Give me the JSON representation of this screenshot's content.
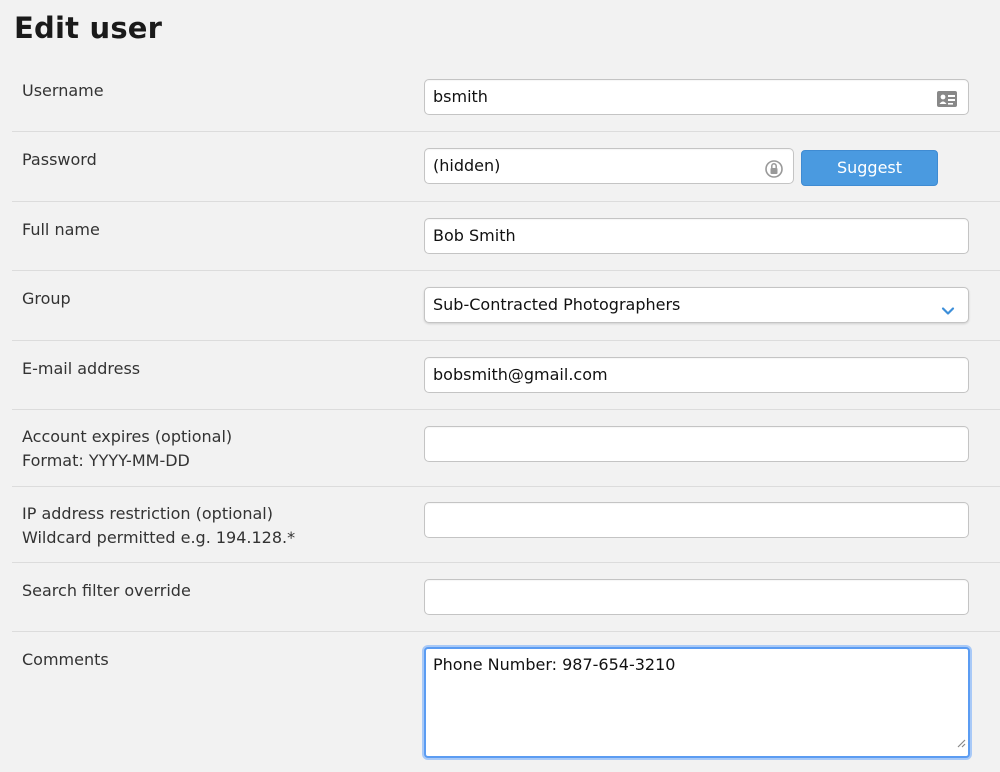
{
  "page": {
    "title": "Edit user"
  },
  "form": {
    "username": {
      "label": "Username",
      "value": "bsmith"
    },
    "password": {
      "label": "Password",
      "value": "(hidden)",
      "suggest_label": "Suggest"
    },
    "fullname": {
      "label": "Full name",
      "value": "Bob Smith"
    },
    "group": {
      "label": "Group",
      "selected": "Sub-Contracted Photographers"
    },
    "email": {
      "label": "E-mail address",
      "value": "bobsmith@gmail.com"
    },
    "expires": {
      "label": "Account expires (optional)",
      "hint": "Format: YYYY-MM-DD",
      "value": ""
    },
    "ip": {
      "label": "IP address restriction (optional)",
      "hint": "Wildcard permitted e.g. 194.128.*",
      "value": ""
    },
    "search_filter": {
      "label": "Search filter override",
      "value": ""
    },
    "comments": {
      "label": "Comments",
      "value": "Phone Number: 987-654-3210"
    }
  },
  "colors": {
    "accent": "#4a9ae0",
    "focus_ring": "#5b9cf2",
    "background": "#f2f2f2"
  },
  "icons": {
    "username_field": "contact-card-icon",
    "password_field": "password-lock-icon",
    "group_dropdown": "chevron-down-icon"
  }
}
